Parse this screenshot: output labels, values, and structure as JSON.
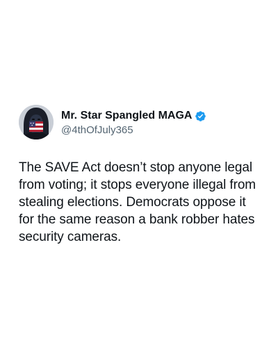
{
  "tweet": {
    "author": {
      "display_name": "Mr. Star Spangled MAGA",
      "handle": "@4thOfJuly365",
      "verified": true,
      "verified_color": "#1d9bf0",
      "avatar_icon": "hooded-figure-flag-avatar"
    },
    "text": "The SAVE Act doesn’t stop anyone legal from voting; it stops everyone illegal from stealing elections. Democrats oppose it for the same reason a bank robber hates security cameras."
  }
}
